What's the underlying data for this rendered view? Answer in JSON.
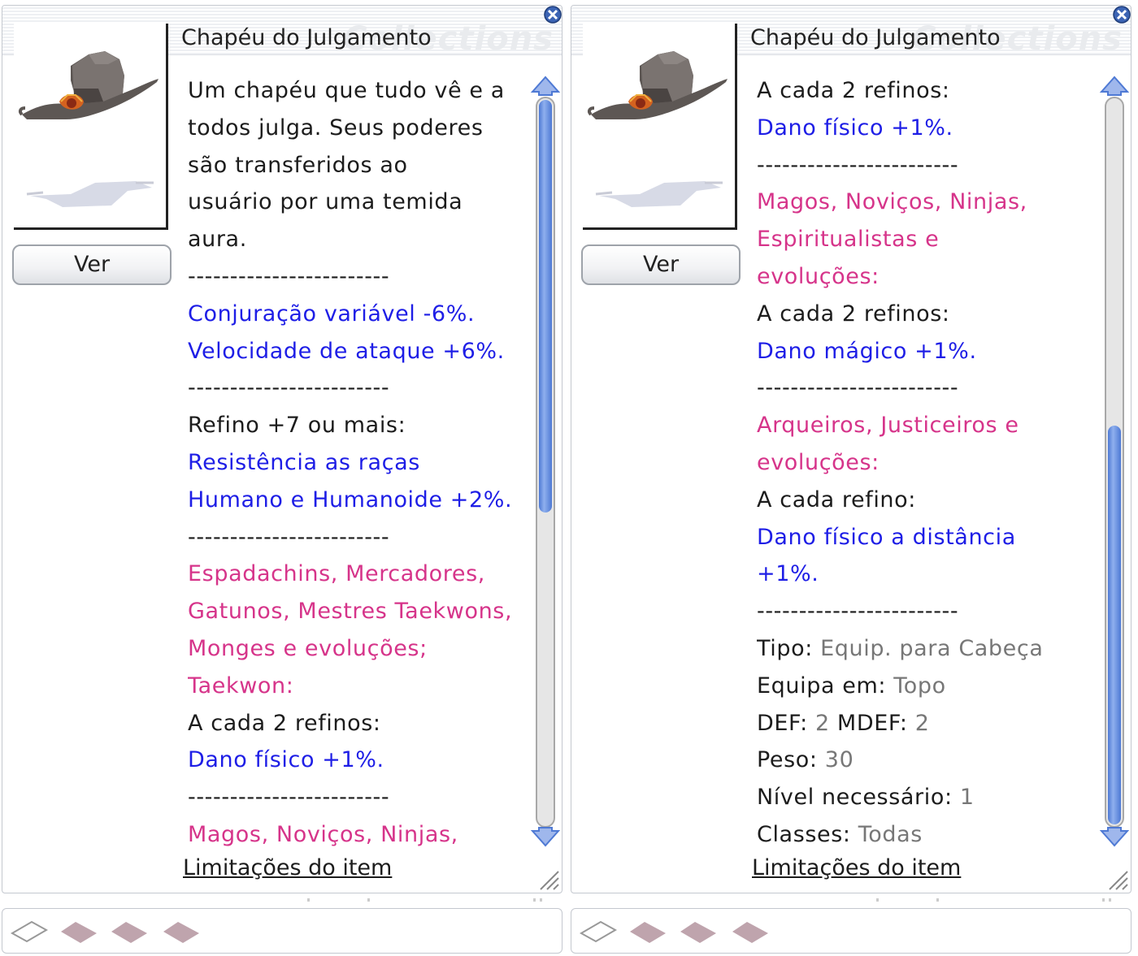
{
  "panels": [
    {
      "title": "Chapéu do Julgamento",
      "watermark": "Collections",
      "ver_label": "Ver",
      "limit_link": "Limitações do item",
      "scroll": {
        "thumb_start": 0.0,
        "thumb_end": 0.57
      },
      "lines": [
        {
          "text": "Um chapéu que tudo vê e a",
          "color": "black"
        },
        {
          "text": "todos julga. Seus poderes",
          "color": "black"
        },
        {
          "text": "são transferidos ao",
          "color": "black"
        },
        {
          "text": "usuário por uma temida",
          "color": "black"
        },
        {
          "text": "aura.",
          "color": "black"
        },
        {
          "text": "------------------------",
          "color": "black"
        },
        {
          "text": "Conjuração variável -6%.",
          "color": "blue"
        },
        {
          "text": "Velocidade de ataque +6%.",
          "color": "blue"
        },
        {
          "text": "------------------------",
          "color": "black"
        },
        {
          "text": "Refino +7 ou mais:",
          "color": "black"
        },
        {
          "text": "Resistência as raças",
          "color": "blue"
        },
        {
          "text": "Humano e Humanoide +2%.",
          "color": "blue"
        },
        {
          "text": "------------------------",
          "color": "black"
        },
        {
          "text": "Espadachins, Mercadores,",
          "color": "pink"
        },
        {
          "text": "Gatunos, Mestres Taekwons,",
          "color": "pink"
        },
        {
          "text": "Monges e evoluções;",
          "color": "pink"
        },
        {
          "text": "Taekwon:",
          "color": "pink"
        },
        {
          "text": "A cada 2 refinos:",
          "color": "black"
        },
        {
          "text": "Dano físico +1%.",
          "color": "blue"
        },
        {
          "text": "------------------------",
          "color": "black"
        },
        {
          "text": "Magos, Noviços, Ninjas,",
          "color": "pink"
        }
      ]
    },
    {
      "title": "Chapéu do Julgamento",
      "watermark": "Collections",
      "ver_label": "Ver",
      "limit_link": "Limitações do item",
      "scroll": {
        "thumb_start": 0.45,
        "thumb_end": 1.0
      },
      "lines": [
        {
          "text": "A cada 2 refinos:",
          "color": "black"
        },
        {
          "text": "Dano físico +1%.",
          "color": "blue"
        },
        {
          "text": "------------------------",
          "color": "black"
        },
        {
          "text": "Magos, Noviços, Ninjas,",
          "color": "pink"
        },
        {
          "text": "Espiritualistas e",
          "color": "pink"
        },
        {
          "text": "evoluções:",
          "color": "pink"
        },
        {
          "text": "A cada 2 refinos:",
          "color": "black"
        },
        {
          "text": "Dano mágico +1%.",
          "color": "blue"
        },
        {
          "text": "------------------------",
          "color": "black"
        },
        {
          "text": "Arqueiros, Justiceiros e",
          "color": "pink"
        },
        {
          "text": "evoluções:",
          "color": "pink"
        },
        {
          "text": "A cada refino:",
          "color": "black"
        },
        {
          "text": "Dano físico a distância",
          "color": "blue"
        },
        {
          "text": "+1%.",
          "color": "blue"
        },
        {
          "text": "------------------------",
          "color": "black"
        },
        {
          "parts": [
            {
              "text": "Tipo: ",
              "color": "black"
            },
            {
              "text": "Equip. para Cabeça",
              "color": "gray"
            }
          ]
        },
        {
          "parts": [
            {
              "text": "Equipa em: ",
              "color": "black"
            },
            {
              "text": "Topo",
              "color": "gray"
            }
          ]
        },
        {
          "parts": [
            {
              "text": "DEF: ",
              "color": "black"
            },
            {
              "text": "2",
              "color": "gray"
            },
            {
              "text": " MDEF: ",
              "color": "black"
            },
            {
              "text": "2",
              "color": "gray"
            }
          ]
        },
        {
          "parts": [
            {
              "text": "Peso: ",
              "color": "black"
            },
            {
              "text": "30",
              "color": "gray"
            }
          ]
        },
        {
          "parts": [
            {
              "text": "Nível necessário: ",
              "color": "black"
            },
            {
              "text": "1",
              "color": "gray"
            }
          ]
        },
        {
          "parts": [
            {
              "text": "Classes: ",
              "color": "black"
            },
            {
              "text": "Todas",
              "color": "gray"
            }
          ]
        }
      ]
    }
  ],
  "icons": {
    "close": "close-icon",
    "hat": "hat-icon",
    "shadow": "card-shadow-icon",
    "scroll_up": "arrow-up-icon",
    "scroll_down": "arrow-down-icon",
    "resize": "resize-grip-icon",
    "slot_empty": "empty-slot-icon",
    "slot_filled": "card-slot-icon"
  },
  "colors": {
    "black": "#1c1c1c",
    "blue": "#1e1ee6",
    "pink": "#d6348a",
    "gray": "#777777",
    "scroll": "#4e79d4"
  }
}
